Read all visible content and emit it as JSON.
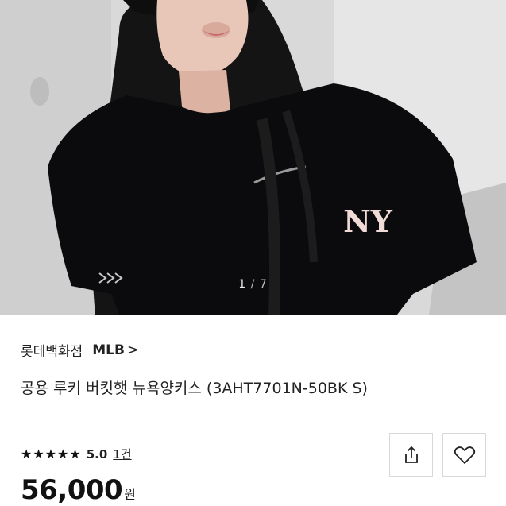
{
  "gallery": {
    "current": "1",
    "separator": "/",
    "total": "7"
  },
  "seller": {
    "store_name": "롯데백화점",
    "brand_name": "MLB",
    "brand_chevron": ">"
  },
  "product": {
    "title": "공용 루키 버킷햇 뉴욕양키스 (3AHT7701N-50BK S)"
  },
  "rating": {
    "stars": "★★★★★",
    "score": "5.0",
    "review_count": "1건"
  },
  "price": {
    "amount": "56,000",
    "currency": "원"
  },
  "actions": {
    "share_icon": "share-icon",
    "wishlist_icon": "heart-outline-icon"
  },
  "colors": {
    "shirt": "#0b0b0d",
    "logo": "#f1dbd6",
    "text": "#222222",
    "border": "#d8d8d8"
  }
}
